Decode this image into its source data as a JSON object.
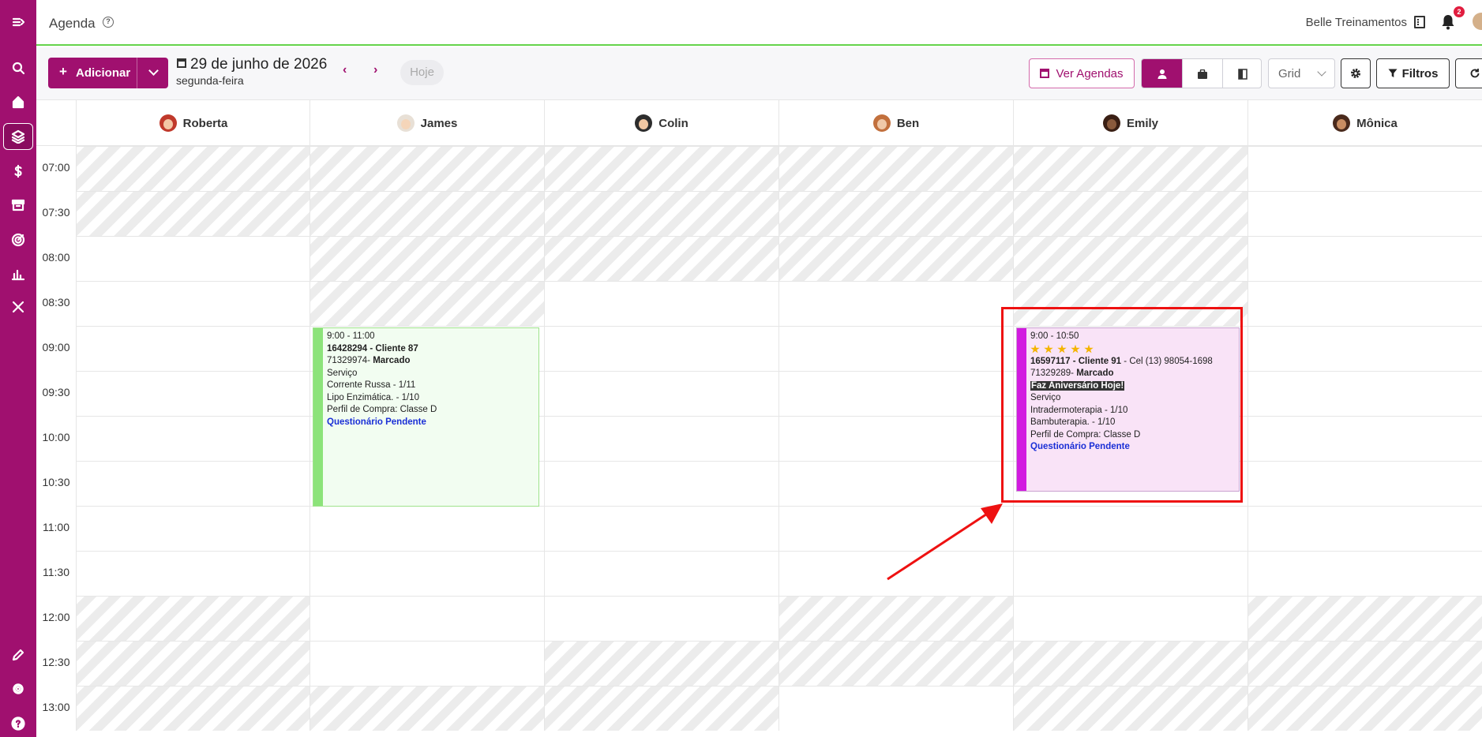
{
  "app": {
    "title": "Agenda",
    "help_icon": "?",
    "company": "Belle Treinamentos",
    "notification_count": "2",
    "accent_color": "#a0106f",
    "header_border_color": "#65d44b"
  },
  "sidebar": {
    "items": [
      {
        "icon": "menu-toggle-icon"
      },
      {
        "icon": "search-icon"
      },
      {
        "icon": "home-icon"
      },
      {
        "icon": "layers-icon",
        "active": true
      },
      {
        "icon": "dollar-icon"
      },
      {
        "icon": "archive-icon"
      },
      {
        "icon": "target-icon"
      },
      {
        "icon": "chart-icon"
      },
      {
        "icon": "tools-icon"
      },
      {
        "icon": "pencil-icon"
      },
      {
        "icon": "gear-icon"
      },
      {
        "icon": "help-icon"
      }
    ]
  },
  "toolbar": {
    "add_plus": "+",
    "add_label": "Adicionar",
    "date": "29 de junho de 2026",
    "weekday": "segunda-feira",
    "prev": "‹",
    "next": "›",
    "today": "Hoje",
    "ver_agendas": "Ver Agendas",
    "view_select": "Grid",
    "filters": "Filtros"
  },
  "professionals": [
    {
      "name": "Roberta",
      "hair": "#c0392b",
      "skin": "#f3c6a5"
    },
    {
      "name": "James",
      "hair": "#e8e0d6",
      "skin": "#f5d5b9"
    },
    {
      "name": "Colin",
      "hair": "#2d2d2d",
      "skin": "#f1c7a2"
    },
    {
      "name": "Ben",
      "hair": "#c2703d",
      "skin": "#f0c9a8"
    },
    {
      "name": "Emily",
      "hair": "#3a1f14",
      "skin": "#8a5a3c"
    },
    {
      "name": "Mônica",
      "hair": "#4a2a1c",
      "skin": "#c98d62"
    }
  ],
  "time_slots": [
    "07:00",
    "07:30",
    "08:00",
    "08:30",
    "09:00",
    "09:30",
    "10:00",
    "10:30",
    "11:00",
    "11:30",
    "12:00",
    "12:30",
    "13:00"
  ],
  "appointments": [
    {
      "column": "James",
      "bar_color": "#8ce37a",
      "bg_color": "#f2fdf1",
      "border_color": "#9fe38c",
      "time": "9:00 - 11:00",
      "client": "16428294 - Cliente 87",
      "client_extra": "",
      "status_code": "71329974-",
      "status": "Marcado",
      "birthday": "",
      "stars": 0,
      "section": "Serviço",
      "services": [
        "Corrente Russa - 1/11",
        "Lipo Enzimática. - 1/10"
      ],
      "profile": "Perfil de Compra: Classe D",
      "pending": "Questionário Pendente"
    },
    {
      "column": "Emily",
      "bar_color": "#d21be0",
      "bg_color": "#f9e3f7",
      "border_color": "#c9a2cf",
      "time": "9:00 - 10:50",
      "client": "16597117 - Cliente 91",
      "client_extra": " - Cel (13) 98054-1698",
      "status_code": "71329289-",
      "status": "Marcado",
      "birthday": "Faz Aniversário Hoje!",
      "stars": 5,
      "section": "Serviço",
      "services": [
        "Intradermoterapia - 1/10",
        "Bambuterapia. - 1/10"
      ],
      "profile": "Perfil de Compra: Classe D",
      "pending": "Questionário Pendente"
    }
  ]
}
